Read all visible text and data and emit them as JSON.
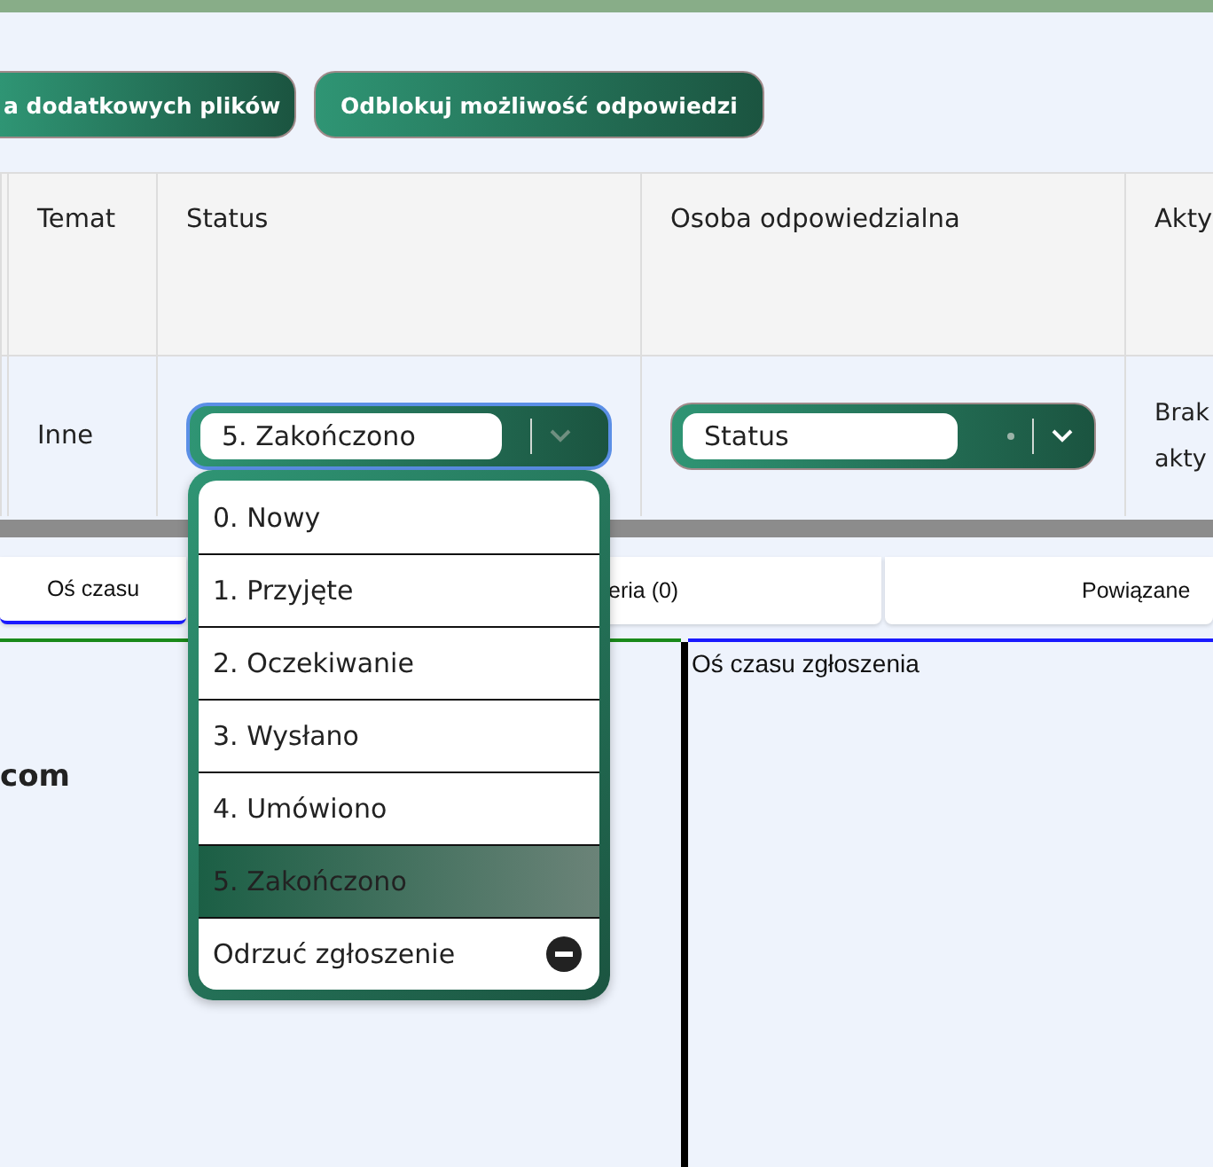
{
  "toolbar": {
    "buttons": [
      "a dodatkowych plików",
      "Odblokuj możliwość odpowiedzi"
    ]
  },
  "table": {
    "columns": [
      "Temat",
      "Status",
      "Osoba odpowiedzialna",
      "Akty"
    ],
    "rows": [
      {
        "temat": "Inne",
        "status": {
          "value": "5. Zakończono",
          "focused": true,
          "open": true
        },
        "osoba": {
          "value": "Status"
        },
        "column_4": "Brak akty"
      }
    ]
  },
  "status_menu": {
    "options": [
      {
        "label": "0. Nowy",
        "kind": "status",
        "selected": false
      },
      {
        "label": "1. Przyjęte",
        "kind": "status",
        "selected": false
      },
      {
        "label": "2. Oczekiwanie",
        "kind": "status",
        "selected": false
      },
      {
        "label": "3. Wysłano",
        "kind": "status",
        "selected": false
      },
      {
        "label": "4. Umówiono",
        "kind": "status",
        "selected": false
      },
      {
        "label": "5. Zakończono",
        "kind": "status",
        "selected": true
      },
      {
        "label": "Odrzuć zgłoszenie",
        "kind": "action",
        "selected": false
      }
    ]
  },
  "tabs": [
    {
      "label": "Oś czasu",
      "selected": true
    },
    {
      "label": "eria (0)",
      "selected": false
    },
    {
      "label": "Powiązane",
      "selected": false
    }
  ],
  "left_panel": {
    "text": "com"
  },
  "right_panel": {
    "title": "Oś czasu zgłoszenia"
  }
}
